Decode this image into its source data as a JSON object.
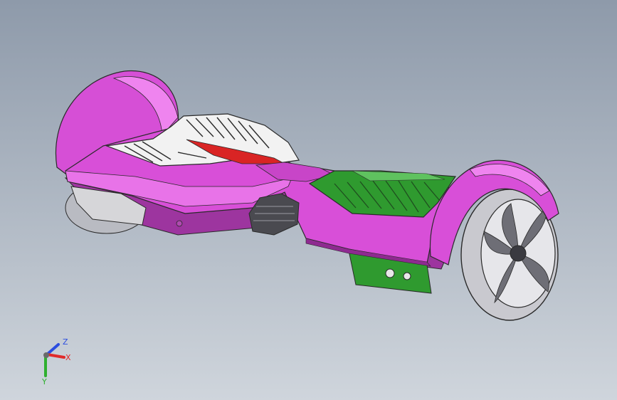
{
  "viewport": {
    "background_top": "#8e9aaa",
    "background_bottom": "#cfd5dc"
  },
  "model": {
    "colors": {
      "shell": "#d84fd8",
      "shell_light": "#f07ef0",
      "shell_dark": "#8e2a90",
      "pad_front": "#2f9a2f",
      "pad_front_light": "#5fc25f",
      "pad_rear": "#f2f2f2",
      "accent": "#d92424",
      "wheel": "#c9c9cf",
      "wheel_dark": "#6e6e76",
      "outline": "#2a2a2a"
    }
  },
  "triad": {
    "icon": "coordinate-axes-icon",
    "z_label": "Z",
    "x_label": "X",
    "y_label": "Y",
    "z_color": "#2b4de0",
    "x_color": "#e02b2b",
    "y_color": "#2fb02f"
  }
}
